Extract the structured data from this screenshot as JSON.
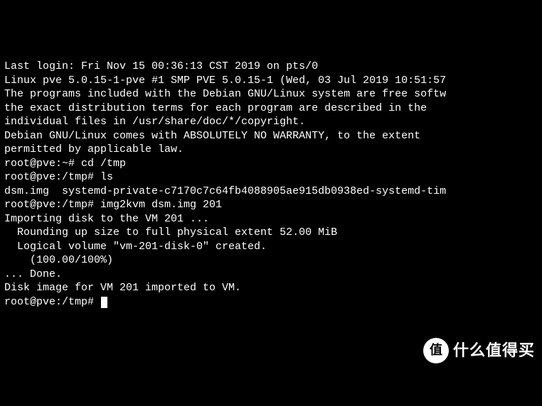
{
  "terminal": {
    "lines": [
      "Last login: Fri Nov 15 00:36:13 CST 2019 on pts/0",
      "Linux pve 5.0.15-1-pve #1 SMP PVE 5.0.15-1 (Wed, 03 Jul 2019 10:51:57",
      "",
      "The programs included with the Debian GNU/Linux system are free softw",
      "the exact distribution terms for each program are described in the",
      "individual files in /usr/share/doc/*/copyright.",
      "",
      "Debian GNU/Linux comes with ABSOLUTELY NO WARRANTY, to the extent",
      "permitted by applicable law.",
      "root@pve:~# cd /tmp",
      "root@pve:/tmp# ls",
      "dsm.img  systemd-private-c7170c7c64fb4088905ae915db0938ed-systemd-tim",
      "root@pve:/tmp# img2kvm dsm.img 201",
      "Importing disk to the VM 201 ...",
      "  Rounding up size to full physical extent 52.00 MiB",
      "  Logical volume \"vm-201-disk-0\" created.",
      "    (100.00/100%)",
      "... Done.",
      "Disk image for VM 201 imported to VM."
    ],
    "prompt": "root@pve:/tmp# "
  },
  "watermark": {
    "badge": "值",
    "text": "什么值得买"
  }
}
